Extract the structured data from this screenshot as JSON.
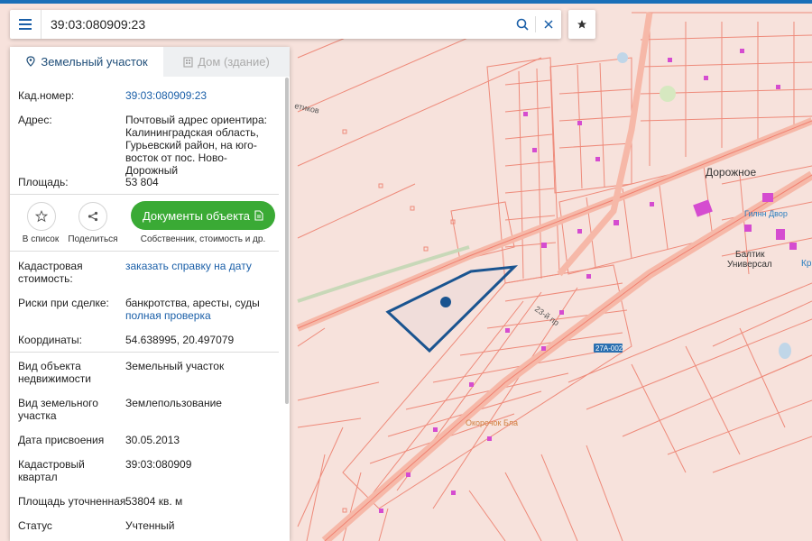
{
  "search": {
    "value": "39:03:080909:23"
  },
  "icons": {
    "menu": "menu-icon",
    "search": "search-icon",
    "clear": "close-icon",
    "favorite": "star-icon"
  },
  "tabs": {
    "land": "Земельный участок",
    "house": "Дом (здание)"
  },
  "info": {
    "cad_label": "Кад.номер:",
    "cad_value": "39:03:080909:23",
    "addr_label": "Адрес:",
    "addr_value": "Почтовый адрес ориентира: Калининградская область, Гурьевский район, на юго-восток от пос. Ново-Дорожный",
    "area_label": "Площадь:",
    "area_value": "53 804"
  },
  "actions": {
    "list_label": "В список",
    "share_label": "Поделиться",
    "docs_label": "Документы объекта",
    "docs_sub": "Собственник, стоимость и др."
  },
  "details": {
    "cost_label": "Кадастровая стоимость:",
    "cost_link": "заказать справку на дату",
    "risk_label": "Риски при сделке:",
    "risk_value": "банкротства, аресты, суды",
    "risk_link": "полная проверка",
    "coords_label": "Координаты:",
    "coords_value": "54.638995, 20.497079",
    "type_label": "Вид объекта недвижимости",
    "type_value": "Земельный участок",
    "use_label": "Вид земельного участка",
    "use_value": "Землепользование",
    "date_label": "Дата присвоения",
    "date_value": "30.05.2013",
    "quarter_label": "Кадастровый квартал",
    "quarter_value": "39:03:080909",
    "area2_label": "Площадь уточненная",
    "area2_value": "53804 кв. м",
    "status_label": "Статус",
    "status_value": "Учтенный"
  },
  "map": {
    "labels": {
      "dorozhnoe": "Дорожное",
      "baltik": "Балтик",
      "universal": "Универсал",
      "kr": "Кр",
      "road": "27А-002",
      "street1": "23-й пр",
      "street2": "етиков",
      "dvor": "Гилнн Двор",
      "shop": "Окорочок Бла"
    },
    "colors": {
      "background": "#f7e2dc",
      "parcel_line": "#ee8a7a",
      "highway": "#f6b8a8",
      "plot": "#1a5490",
      "buildings": "#d54cd0"
    }
  }
}
